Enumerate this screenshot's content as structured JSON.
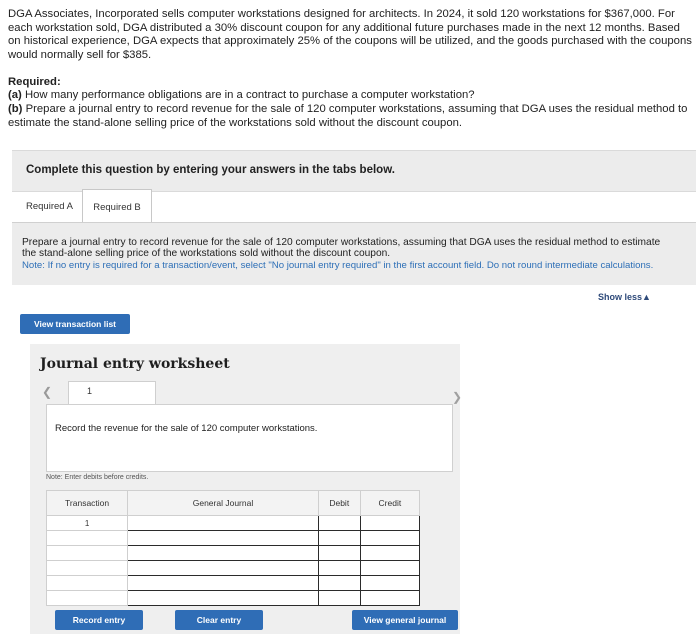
{
  "problem": {
    "text": "DGA Associates, Incorporated sells computer workstations designed for architects. In 2024, it sold 120 workstations for $367,000. For each workstation sold, DGA distributed a 30% discount coupon for any additional future purchases made in the next 12 months. Based on historical experience, DGA expects that approximately 25% of the coupons will be utilized, and the goods purchased with the coupons would normally sell for $385."
  },
  "required": {
    "title": "Required:",
    "a_label": "(a)",
    "a_text": " How many performance obligations are in a contract to purchase a computer workstation?",
    "b_label": "(b)",
    "b_text": " Prepare a journal entry to record revenue for the sale of 120 computer workstations, assuming that DGA uses the residual method to estimate the stand-alone selling price of the workstations sold without the discount coupon."
  },
  "complete_bar": "Complete this question by entering your answers in the tabs below.",
  "tabs": [
    {
      "label": "Required A",
      "active": false
    },
    {
      "label": "Required B",
      "active": true
    }
  ],
  "instructions": {
    "main": "Prepare a journal entry to record revenue for the sale of 120 computer workstations, assuming that DGA uses the residual method to estimate the stand-alone selling price of the workstations sold without the discount coupon.",
    "note": "Note: If no entry is required for a transaction/event, select \"No journal entry required\" in the first account field. Do not round intermediate calculations."
  },
  "show_less": "Show less▲",
  "buttons": {
    "view_transaction_list": "View transaction list",
    "record_entry": "Record entry",
    "clear_entry": "Clear entry",
    "view_general_journal": "View general journal"
  },
  "worksheet": {
    "title": "Journal entry worksheet",
    "page_number": "1",
    "description": "Record the revenue for the sale of 120 computer workstations.",
    "note": "Note: Enter debits before credits.",
    "columns": [
      "Transaction",
      "General Journal",
      "Debit",
      "Credit"
    ],
    "transaction_number": "1",
    "row_count": 6
  },
  "icons": {
    "prev": "chevron-left-icon",
    "next": "chevron-right-icon"
  },
  "colors": {
    "accent_button": "#2f6db6",
    "note_text": "#2d6fb7",
    "panel_gray": "#ececec"
  }
}
